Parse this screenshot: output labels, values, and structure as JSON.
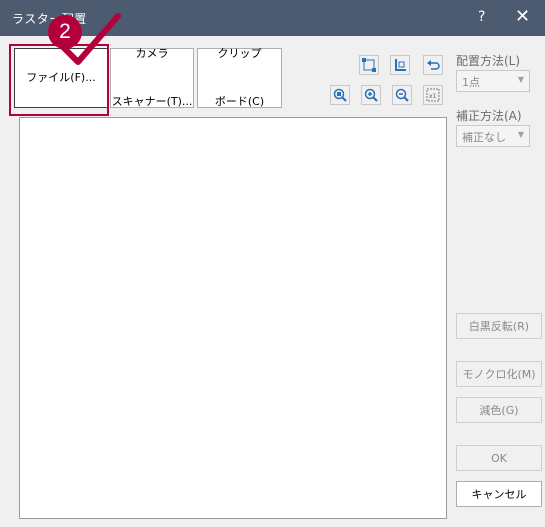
{
  "window": {
    "title": "ラスター配置",
    "help_label": "?",
    "close_label": "✕"
  },
  "callout": {
    "number": "2"
  },
  "source_buttons": {
    "file": {
      "line1": "ファイル(F)..."
    },
    "camera": {
      "line1": "カメラ",
      "line2": "スキャナー(T)..."
    },
    "clipboard": {
      "line1": "クリップ",
      "line2": "ボード(C)"
    }
  },
  "toolbar": {
    "icons": [
      "two-point-icon",
      "vertical-fit-icon",
      "undo-icon",
      "zoom-fit-icon",
      "zoom-in-icon",
      "zoom-out-icon",
      "actual-size-icon"
    ],
    "actual_size_label": "x1"
  },
  "placement": {
    "label": "配置方法(L)",
    "value": "1点"
  },
  "correction": {
    "label": "補正方法(A)",
    "value": "補正なし"
  },
  "actions": {
    "invert": "白黒反転(R)",
    "mono": "モノクロ化(M)",
    "reduce": "減色(G)",
    "ok": "OK",
    "cancel": "キャンセル"
  },
  "colors": {
    "accent": "#b3003a",
    "titlebar": "#4d5b70"
  }
}
